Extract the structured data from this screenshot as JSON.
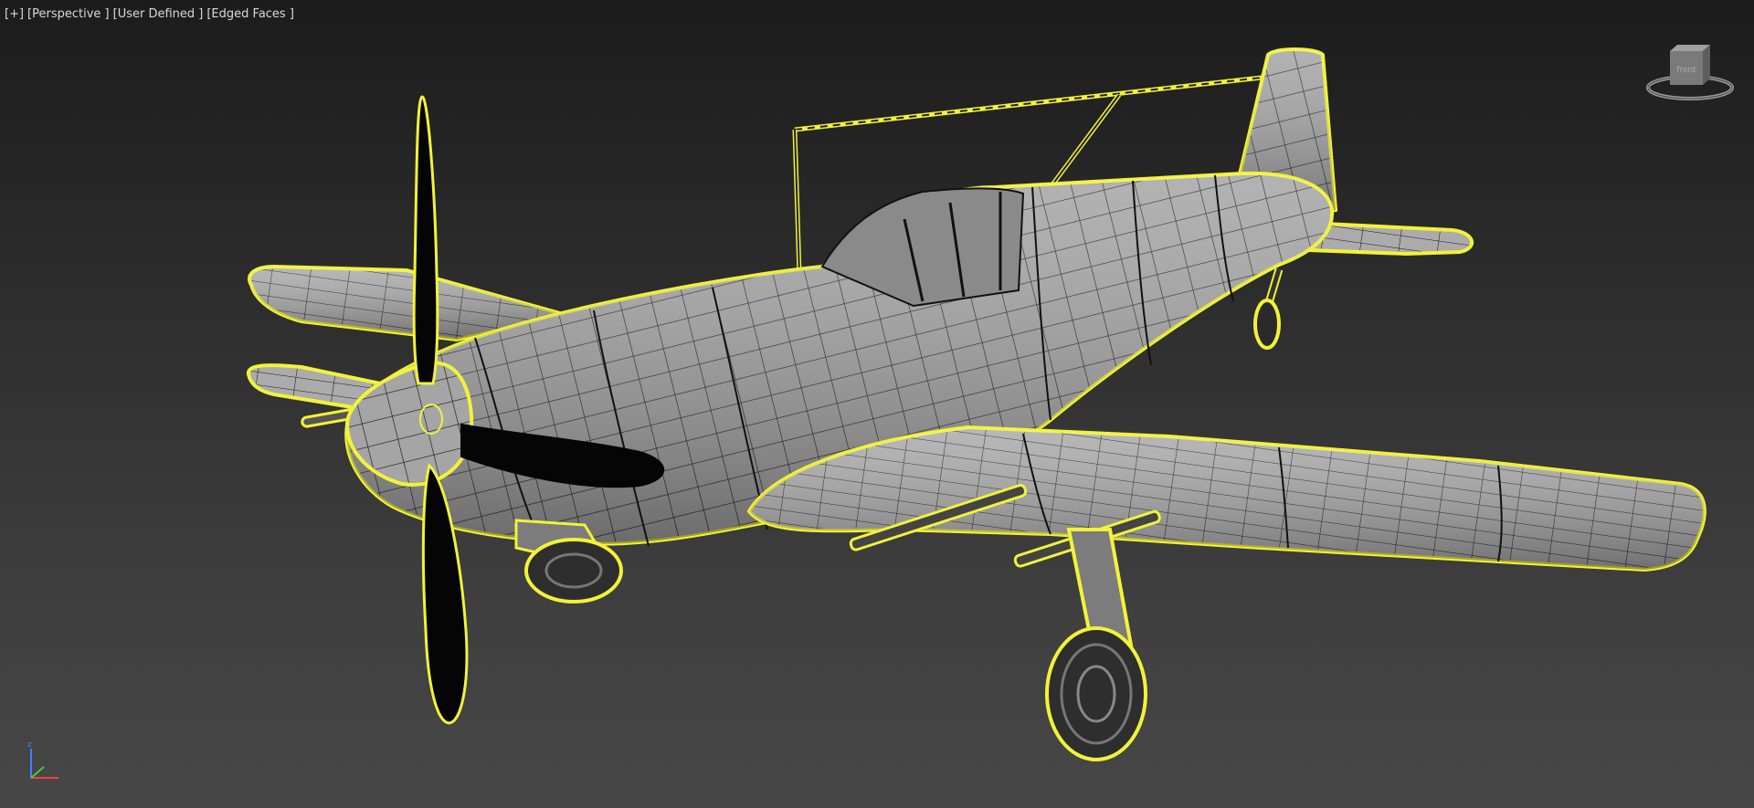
{
  "viewport": {
    "labels": {
      "plus": "[+]",
      "view": "[Perspective ]",
      "shading": "[User Defined ]",
      "mode": "[Edged Faces ]"
    },
    "viewcube_face": "front",
    "axis": {
      "z": "z"
    }
  },
  "colors": {
    "selection_outline": "#f2f23a",
    "mesh_fill": "#9a9a9a",
    "mesh_edge": "#141414",
    "propeller": "#050505"
  },
  "icons": [
    "viewcube-icon",
    "axis-tripod-icon"
  ]
}
